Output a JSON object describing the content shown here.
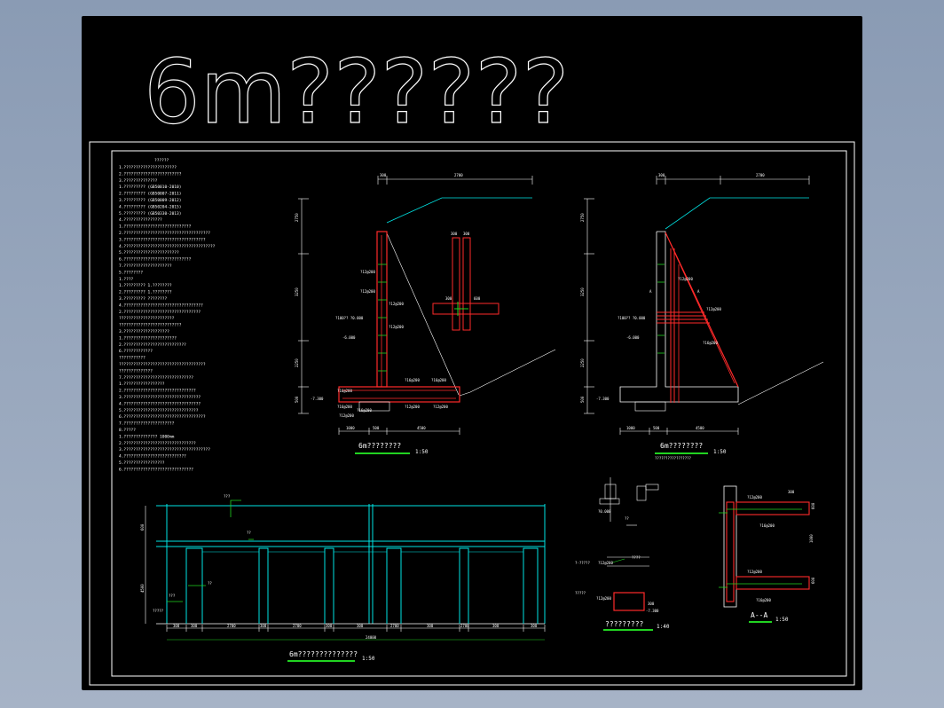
{
  "drawing_title": "6m??????",
  "notes": {
    "heading": "??????",
    "lines": [
      "1.??????????????????????",
      "2.????????????????????????",
      "3.??????????????",
      "   1.?????????         (GB50010-2010)",
      "   2.?????????         (GB50007-2011)",
      "   3.?????????         (GB50009-2012)",
      "   4.?????????         (GB50204-2015)",
      "   5.?????????         (GB50330-2013)",
      "4.????????????????",
      "   1.????????????????????????????",
      "   2.????????????????????????????????????",
      "   3.??????????????????????????????????",
      "   4.??????????????????????????????????????",
      "   5.???????????????????????",
      "   6.????????????????????????????",
      "   7.????????????????????",
      "5.????????",
      "   1.????",
      "     1.????????? 1.????????",
      "     2.????????? 1.????????",
      "     3.????????? ????????",
      "     4.?????????????????????????????????",
      "   2.????????????????????????????????",
      "     ???????????????????????",
      "     ??????????????????????????",
      "   3.???????????????????",
      "     1.??????????????????????",
      "     2.??????????????????????????",
      "6.????????????",
      "     ???????????",
      "     ????????????????????????????????????",
      "     ??????????????",
      "7.?????????????????????????????",
      "   1.?????????????????",
      "   2.??????????????????????????????",
      "   3.????????????????????????????????",
      "   4.????????????????????????????????",
      "   5.???????????????????????????????",
      "   6.??????????????????????????????????",
      "   7.?????????????????????",
      "8.?????",
      "   1.?????????????? 1000mm",
      "   2.??????????????????????????????",
      "   3.????????????????????????????????????",
      "   4.??????????????????????????",
      "   5.?????????????????",
      "   6.?????????????????????????????"
    ]
  },
  "section1": {
    "caption": "6m????????",
    "scale": "1:50",
    "dims_top": [
      "300",
      "2700"
    ],
    "dims_left": [
      "2750",
      "3250",
      "2250",
      "500"
    ],
    "dims_bottom": [
      "1000",
      "500",
      "4500"
    ],
    "labels": [
      "?12@200",
      "?12@200",
      "?12@200",
      "?12@200",
      "?16@200",
      "?16@200",
      "?16@200",
      "?16@200",
      "?16@200",
      "?12@200",
      "?12@200",
      "?12@200",
      "?100?? ?0.000",
      "-6.000",
      "-7.300"
    ],
    "detail": {
      "dims": [
        "300",
        "300",
        "300",
        "600"
      ]
    }
  },
  "section2": {
    "caption": "6m????????",
    "subcaption": "?????????????????",
    "scale": "1:50",
    "dims_top": [
      "300",
      "2700"
    ],
    "dims_left": [
      "2750",
      "3250",
      "2250",
      "500"
    ],
    "dims_bottom": [
      "1000",
      "500",
      "4500"
    ],
    "labels": [
      "?12@200",
      "?12@200",
      "?16@200",
      "A",
      "A",
      "?100?? ?0.000",
      "-6.000",
      "-7.300"
    ]
  },
  "elevation": {
    "caption": "6m??????????????",
    "scale": "1:50",
    "labels": [
      "???",
      "??",
      "??",
      "???",
      "?????"
    ],
    "dims_bottom": [
      "300",
      "300",
      "2700",
      "300",
      "2700",
      "300",
      "300",
      "2700",
      "300",
      "2700",
      "300",
      "300"
    ],
    "total": "24000",
    "dims_left": [
      "600",
      "4500"
    ]
  },
  "details": {
    "caption": "?????????",
    "scale": "1:40",
    "labels": [
      "?0.000",
      "??",
      "?-?????",
      "?12@200",
      "????",
      "?????",
      "?12@200",
      "300",
      "-7.300"
    ]
  },
  "section_aa": {
    "caption": "A--A",
    "scale": "1:50",
    "labels": [
      "?12@200",
      "?16@200",
      "?12@200",
      "?16@200",
      "300",
      "1000",
      "600",
      "600"
    ]
  },
  "colors": {
    "red": "#ff2a2a",
    "green": "#21d321",
    "cyan": "#00e5e5",
    "white": "#ffffff"
  }
}
